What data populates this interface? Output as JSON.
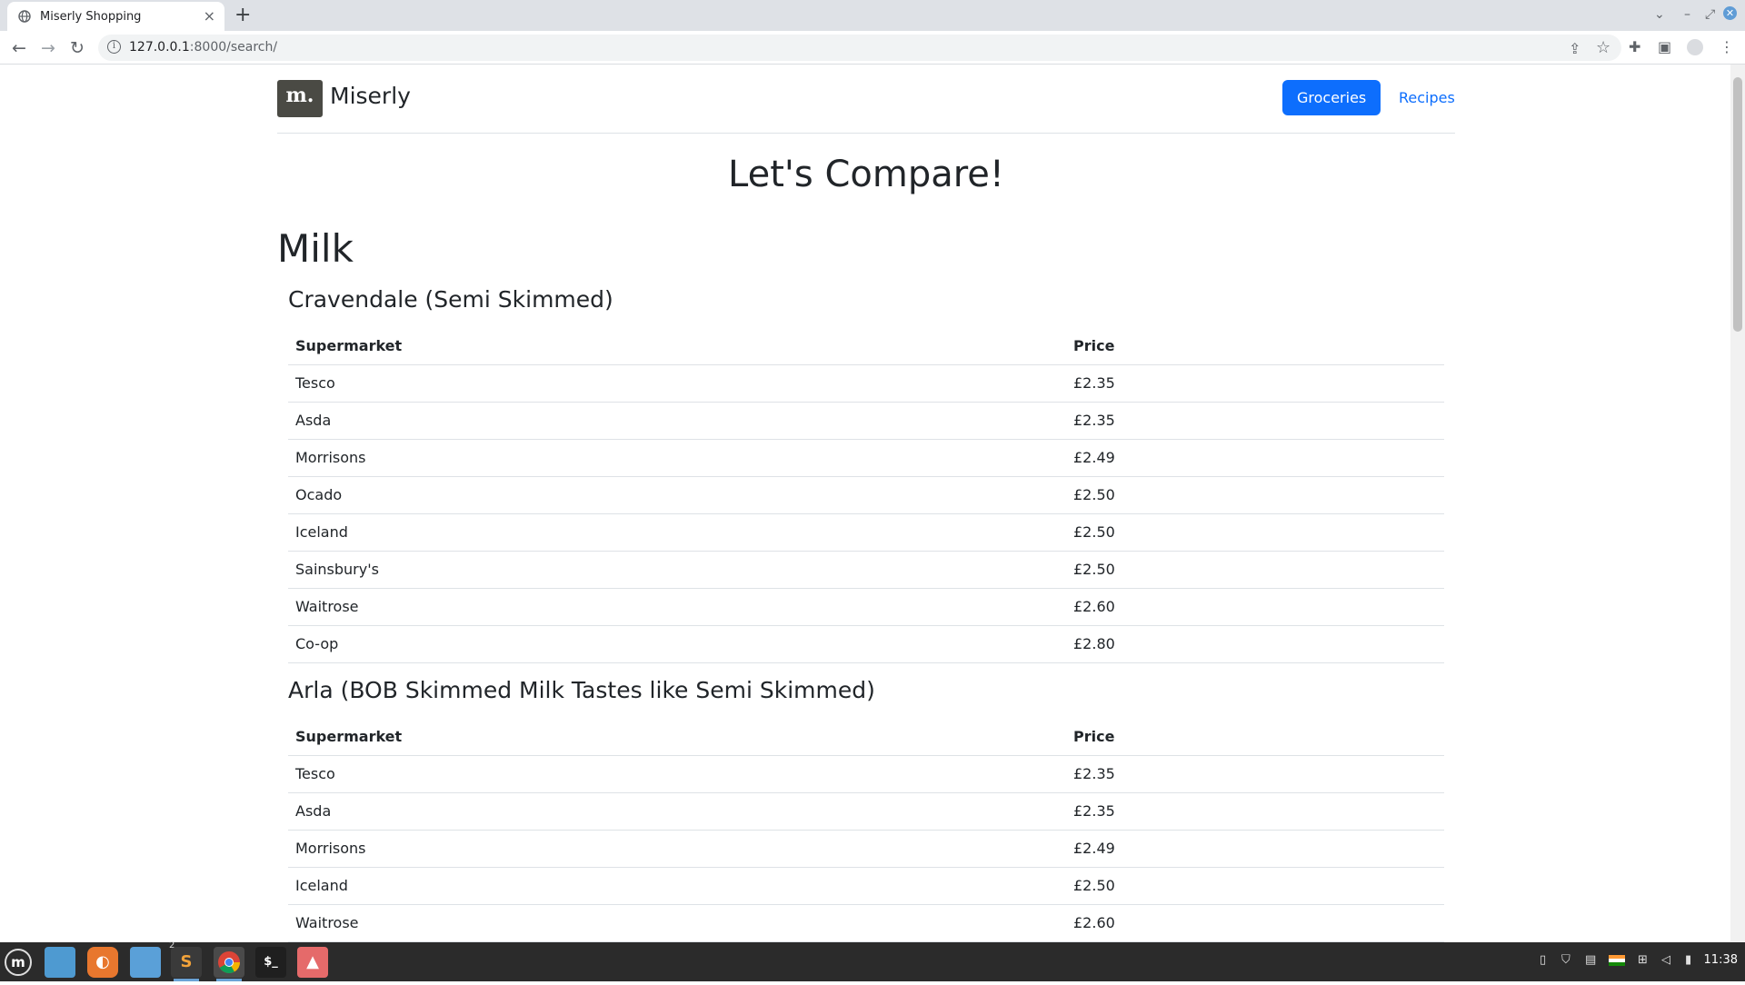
{
  "browser": {
    "tab_title": "Miserly Shopping",
    "tab_close": "×",
    "new_tab": "+",
    "url_host": "127.0.0.1",
    "url_rest": ":8000/search/"
  },
  "site": {
    "logo_text": "m.",
    "brand": "Miserly",
    "nav": [
      {
        "label": "Groceries",
        "active": true
      },
      {
        "label": "Recipes",
        "active": false
      }
    ],
    "heading": "Let's Compare!",
    "category": "Milk"
  },
  "products": [
    {
      "name": "Cravendale (Semi Skimmed)",
      "columns": [
        "Supermarket",
        "Price"
      ],
      "rows": [
        [
          "Tesco",
          "£2.35"
        ],
        [
          "Asda",
          "£2.35"
        ],
        [
          "Morrisons",
          "£2.49"
        ],
        [
          "Ocado",
          "£2.50"
        ],
        [
          "Iceland",
          "£2.50"
        ],
        [
          "Sainsbury's",
          "£2.50"
        ],
        [
          "Waitrose",
          "£2.60"
        ],
        [
          "Co-op",
          "£2.80"
        ]
      ]
    },
    {
      "name": "Arla (BOB Skimmed Milk Tastes like Semi Skimmed)",
      "columns": [
        "Supermarket",
        "Price"
      ],
      "rows": [
        [
          "Tesco",
          "£2.35"
        ],
        [
          "Asda",
          "£2.35"
        ],
        [
          "Morrisons",
          "£2.49"
        ],
        [
          "Iceland",
          "£2.50"
        ],
        [
          "Waitrose",
          "£2.60"
        ]
      ]
    }
  ],
  "taskbar": {
    "clock": "11:38",
    "sublime_badge": "2"
  },
  "colors": {
    "accent": "#0d6efd",
    "logo_bg": "#4a4a44",
    "taskbar_bg": "#2b2b2b"
  }
}
